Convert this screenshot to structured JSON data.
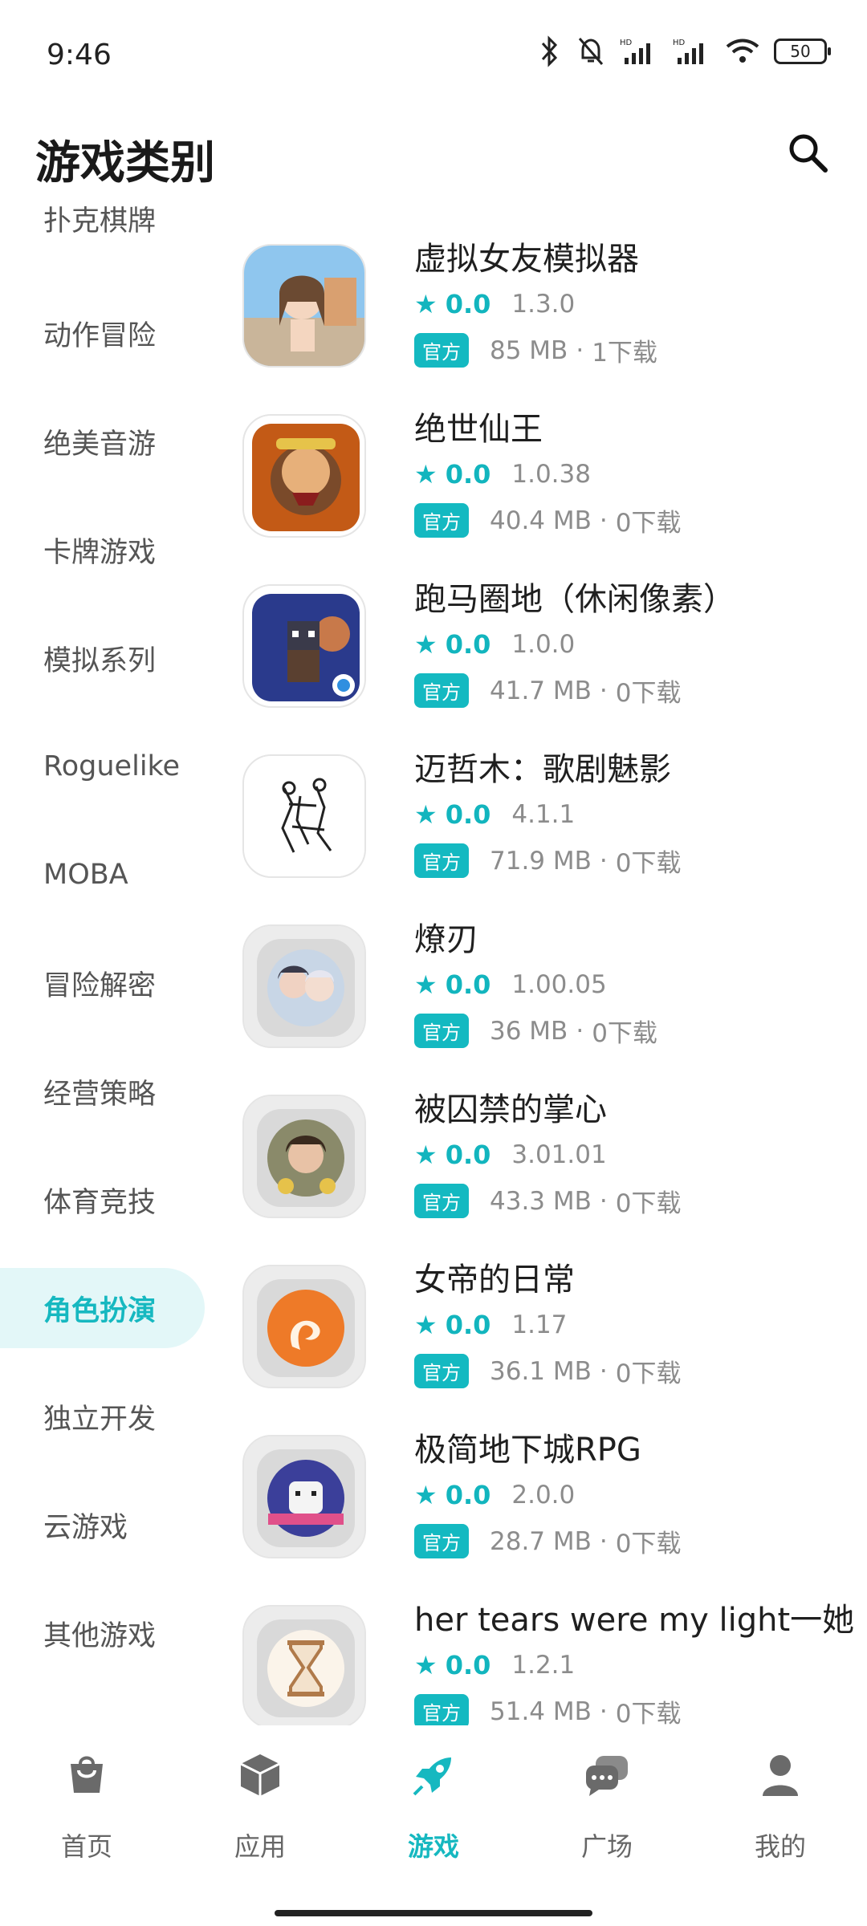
{
  "status": {
    "time": "9:46",
    "battery": "50"
  },
  "header": {
    "title": "游戏类别"
  },
  "sidebar": {
    "categories": [
      {
        "label": "扑克棋牌"
      },
      {
        "label": "动作冒险"
      },
      {
        "label": "绝美音游"
      },
      {
        "label": "卡牌游戏"
      },
      {
        "label": "模拟系列"
      },
      {
        "label": "Roguelike"
      },
      {
        "label": "MOBA"
      },
      {
        "label": "冒险解密"
      },
      {
        "label": "经营策略"
      },
      {
        "label": "体育竞技"
      },
      {
        "label": "角色扮演"
      },
      {
        "label": "独立开发"
      },
      {
        "label": "云游戏"
      },
      {
        "label": "其他游戏"
      }
    ],
    "active_index": 10
  },
  "games": [
    {
      "name": "虚拟女友模拟器",
      "rating": "0.0",
      "version": "1.3.0",
      "badge": "官方",
      "size": "85 MB",
      "downloads": "1下载",
      "icon": "anime-girl-icon"
    },
    {
      "name": "绝世仙王",
      "rating": "0.0",
      "version": "1.0.38",
      "badge": "官方",
      "size": "40.4 MB",
      "downloads": "0下载",
      "icon": "monkey-king-icon"
    },
    {
      "name": "跑马圈地（休闲像素）",
      "rating": "0.0",
      "version": "1.0.0",
      "badge": "官方",
      "size": "41.7 MB",
      "downloads": "0下载",
      "icon": "pixel-cat-hero-icon"
    },
    {
      "name": "迈哲木：歌剧魅影",
      "rating": "0.0",
      "version": "4.1.1",
      "badge": "官方",
      "size": "71.9 MB",
      "downloads": "0下载",
      "icon": "sketch-figures-icon"
    },
    {
      "name": "燎刃",
      "rating": "0.0",
      "version": "1.00.05",
      "badge": "官方",
      "size": "36 MB",
      "downloads": "0下载",
      "icon": "anime-duo-icon"
    },
    {
      "name": "被囚禁的掌心",
      "rating": "0.0",
      "version": "3.01.01",
      "badge": "官方",
      "size": "43.3 MB",
      "downloads": "0下载",
      "icon": "portrait-man-icon"
    },
    {
      "name": "女帝的日常",
      "rating": "0.0",
      "version": "1.17",
      "badge": "官方",
      "size": "36.1 MB",
      "downloads": "0下载",
      "icon": "phoenix-icon"
    },
    {
      "name": "极简地下城RPG",
      "rating": "0.0",
      "version": "2.0.0",
      "badge": "官方",
      "size": "28.7 MB",
      "downloads": "0下载",
      "icon": "ghost-dungeon-icon"
    },
    {
      "name": "her tears were my light一她",
      "rating": "0.0",
      "version": "1.2.1",
      "badge": "官方",
      "size": "51.4 MB",
      "downloads": "0下载",
      "icon": "hourglass-icon"
    }
  ],
  "nav": [
    {
      "label": "首页",
      "icon": "shopping-bag-icon"
    },
    {
      "label": "应用",
      "icon": "cube-icon"
    },
    {
      "label": "游戏",
      "icon": "rocket-icon"
    },
    {
      "label": "广场",
      "icon": "chat-bubbles-icon"
    },
    {
      "label": "我的",
      "icon": "person-icon"
    }
  ],
  "nav_active_index": 2,
  "colors": {
    "accent": "#14b9c1",
    "active_bg": "#e3f7f8",
    "text": "#222222",
    "muted": "#8c8c8c"
  }
}
